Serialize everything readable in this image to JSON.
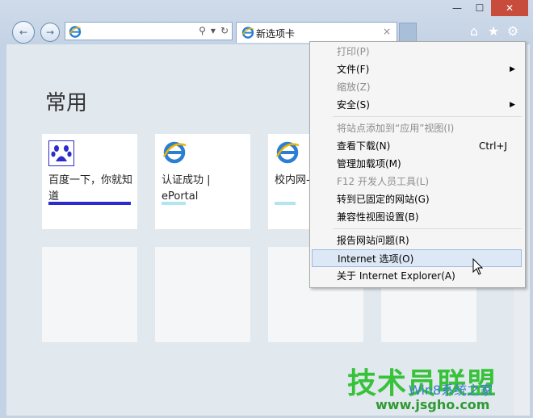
{
  "window": {
    "minimize": "—",
    "maximize": "☐",
    "close": "✕"
  },
  "nav": {
    "back_glyph": "←",
    "forward_glyph": "→",
    "address": "",
    "address_icons": [
      "search-icon",
      "dropdown-icon",
      "refresh-icon"
    ]
  },
  "tab": {
    "title": "新选项卡",
    "close_glyph": "×"
  },
  "toolbar_icons": [
    "home-icon",
    "favorites-star-icon",
    "tools-gear-icon"
  ],
  "page": {
    "heading": "常用",
    "tiles": [
      {
        "label": "百度一下，你就知道",
        "accent": "#2c2ccc",
        "icon": "baidu-paw-icon"
      },
      {
        "label": "认证成功 | ePortal",
        "accent": "#b2e6ee",
        "icon": "ie-icon"
      },
      {
        "label": "校内网-校内网",
        "accent": "#b2e6ee",
        "icon": "ie-icon"
      }
    ]
  },
  "menu": {
    "items": [
      {
        "label": "打印(P)",
        "disabled": true
      },
      {
        "label": "文件(F)",
        "submenu": true
      },
      {
        "label": "缩放(Z)",
        "disabled": true
      },
      {
        "label": "安全(S)",
        "submenu": true
      },
      {
        "label": "将站点添加到“应用”视图(I)",
        "disabled": true
      },
      {
        "label": "查看下载(N)",
        "shortcut": "Ctrl+J"
      },
      {
        "label": "管理加载项(M)"
      },
      {
        "label": "F12 开发人员工具(L)",
        "disabled": true
      },
      {
        "label": "转到已固定的网站(G)"
      },
      {
        "label": "兼容性视图设置(B)"
      },
      {
        "label": "报告网站问题(R)"
      },
      {
        "label": "Internet 选项(O)",
        "highlighted": true
      },
      {
        "label": "关于 Internet Explorer(A)"
      }
    ]
  },
  "watermark": {
    "brand": "技术员联盟",
    "sub": "Win8系统之家",
    "url": "www.jsgho.com"
  }
}
